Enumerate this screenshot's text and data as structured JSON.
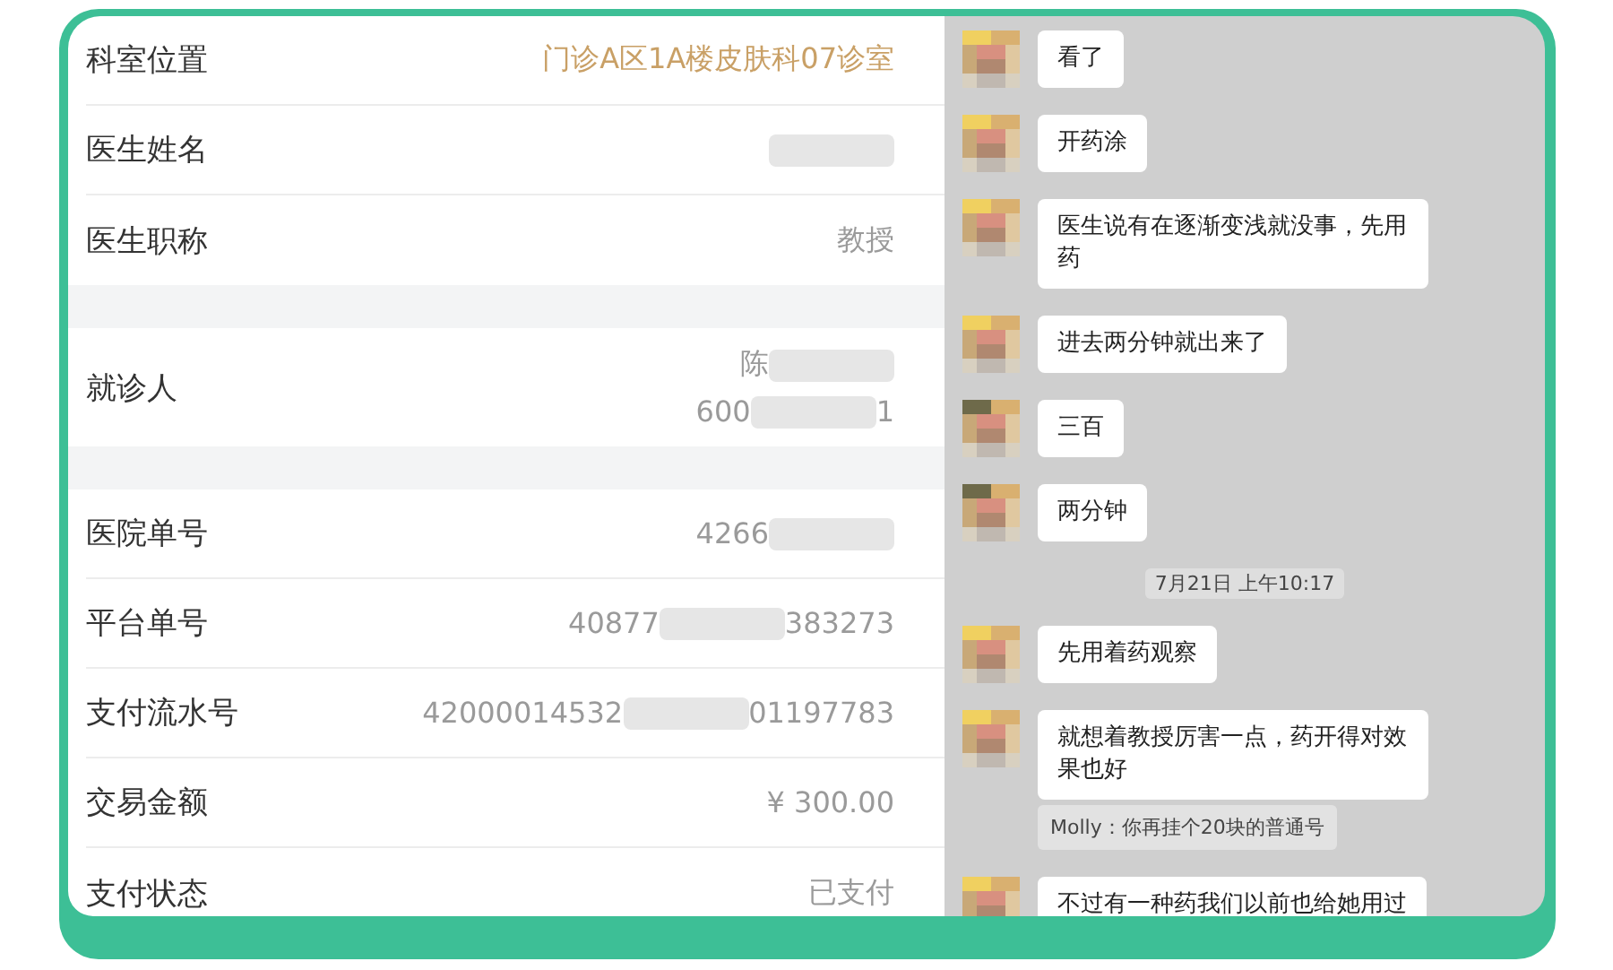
{
  "order_details": {
    "sections": [
      {
        "rows": [
          {
            "label": "科室位置",
            "highlight": true,
            "lines": [
              [
                {
                  "kind": "text",
                  "text": "门诊A区1A楼皮肤科07诊室"
                }
              ]
            ]
          },
          {
            "label": "医生姓名",
            "highlight": false,
            "lines": [
              [
                {
                  "kind": "redaction"
                }
              ]
            ]
          },
          {
            "label": "医生职称",
            "highlight": false,
            "lines": [
              [
                {
                  "kind": "text",
                  "text": "教授"
                }
              ]
            ]
          }
        ]
      },
      {
        "rows": [
          {
            "label": "就诊人",
            "highlight": false,
            "lines": [
              [
                {
                  "kind": "text",
                  "text": "陈"
                },
                {
                  "kind": "redaction"
                }
              ],
              [
                {
                  "kind": "text",
                  "text": "600"
                },
                {
                  "kind": "redaction"
                },
                {
                  "kind": "text",
                  "text": "1"
                }
              ]
            ]
          }
        ]
      },
      {
        "rows": [
          {
            "label": "医院单号",
            "highlight": false,
            "lines": [
              [
                {
                  "kind": "text",
                  "text": "4266"
                },
                {
                  "kind": "redaction"
                }
              ]
            ]
          },
          {
            "label": "平台单号",
            "highlight": false,
            "lines": [
              [
                {
                  "kind": "text",
                  "text": "40877"
                },
                {
                  "kind": "redaction"
                },
                {
                  "kind": "text",
                  "text": "383273"
                }
              ]
            ]
          },
          {
            "label": "支付流水号",
            "highlight": false,
            "lines": [
              [
                {
                  "kind": "text",
                  "text": "42000014532"
                },
                {
                  "kind": "redaction"
                },
                {
                  "kind": "text",
                  "text": "01197783"
                }
              ]
            ]
          },
          {
            "label": "交易金额",
            "highlight": false,
            "lines": [
              [
                {
                  "kind": "text",
                  "text": "¥ 300.00"
                }
              ]
            ]
          },
          {
            "label": "支付状态",
            "highlight": false,
            "lines": [
              [
                {
                  "kind": "text",
                  "text": "已支付"
                }
              ]
            ]
          }
        ]
      }
    ]
  },
  "chat": {
    "items": [
      {
        "kind": "message",
        "color": "#f0d060",
        "text": "看了"
      },
      {
        "kind": "message",
        "color": "#f0d060",
        "text": "开药涂"
      },
      {
        "kind": "message",
        "color": "#f0d060",
        "text": "医生说有在逐渐变浅就没事，先用药"
      },
      {
        "kind": "message",
        "color": "#f0d060",
        "text": "进去两分钟就出来了"
      },
      {
        "kind": "message",
        "color": "#6e6a4a",
        "text": "三百"
      },
      {
        "kind": "message",
        "color": "#6e6a4a",
        "text": "两分钟"
      },
      {
        "kind": "timestamp",
        "text": "7月21日 上午10:17"
      },
      {
        "kind": "message",
        "color": "#f0d060",
        "text": "先用着药观察"
      },
      {
        "kind": "message",
        "color": "#f0d060",
        "text": "就想着教授厉害一点，药开得对效果也好"
      },
      {
        "kind": "quote",
        "text": "Molly：你再挂个20块的普通号"
      },
      {
        "kind": "message",
        "color": "#f0d060",
        "text": "不过有一种药我们以前也给她用过"
      }
    ]
  }
}
